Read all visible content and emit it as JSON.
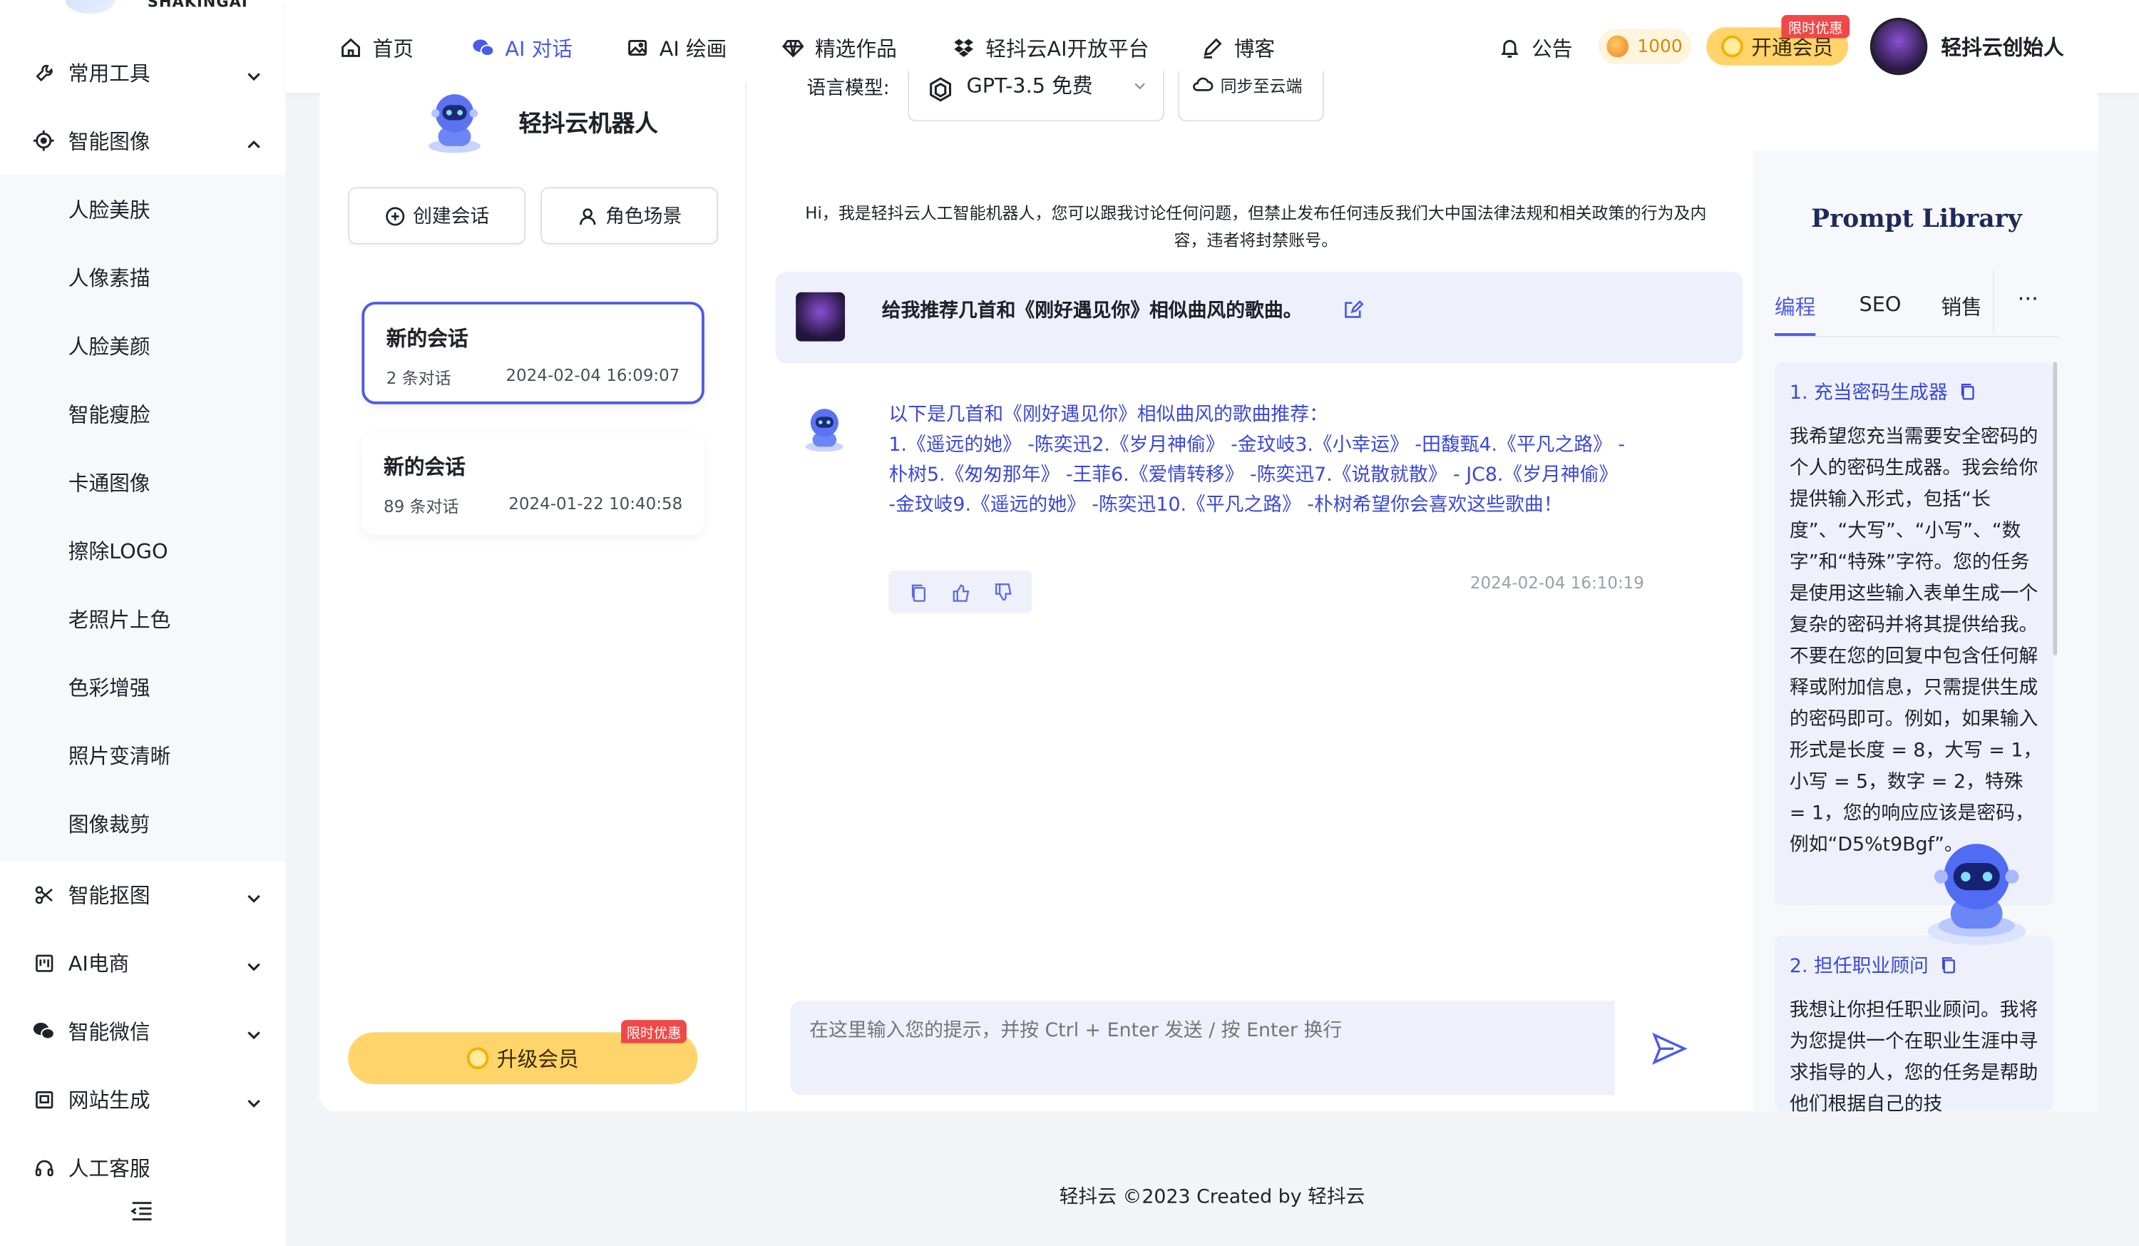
{
  "brand": {
    "logo_text": "SHAKINGAI"
  },
  "sidebar": {
    "items": [
      {
        "label": "常用工具",
        "icon": "wrench-icon"
      },
      {
        "label": "智能图像",
        "icon": "target-icon"
      },
      {
        "label": "智能抠图",
        "icon": "scissors-icon"
      },
      {
        "label": "AI电商",
        "icon": "store-icon"
      },
      {
        "label": "智能微信",
        "icon": "wechat-icon"
      },
      {
        "label": "网站生成",
        "icon": "web-icon"
      },
      {
        "label": "人工客服",
        "icon": "headset-icon"
      }
    ],
    "sub_items": [
      "人脸美肤",
      "人像素描",
      "人脸美颜",
      "智能瘦脸",
      "卡通图像",
      "擦除LOGO",
      "老照片上色",
      "色彩增强",
      "照片变清晰",
      "图像裁剪"
    ]
  },
  "topnav": {
    "items": [
      {
        "label": "首页",
        "icon": "home-icon"
      },
      {
        "label": "AI 对话",
        "icon": "wechat-icon"
      },
      {
        "label": "AI 绘画",
        "icon": "image-icon"
      },
      {
        "label": "精选作品",
        "icon": "diamond-icon"
      },
      {
        "label": "轻抖云AI开放平台",
        "icon": "dropbox-icon"
      },
      {
        "label": "博客",
        "icon": "pen-icon"
      },
      {
        "label": "公告",
        "icon": "bell-icon"
      }
    ],
    "coins": "1000",
    "vip_label": "开通会员",
    "vip_tag": "限时优惠",
    "user_name": "轻抖云创始人"
  },
  "left_panel": {
    "bot_name": "轻抖云机器人",
    "create_label": "创建会话",
    "role_label": "角色场景",
    "conversations": [
      {
        "title": "新的会话",
        "count": "2 条对话",
        "time": "2024-02-04 16:09:07"
      },
      {
        "title": "新的会话",
        "count": "89 条对话",
        "time": "2024-01-22 10:40:58"
      }
    ],
    "upgrade_label": "升级会员",
    "upgrade_tag": "限时优惠"
  },
  "chat": {
    "model_label": "语言模型:",
    "model_value": "GPT-3.5 免费",
    "sync_label": "同步至云端",
    "notice": "Hi，我是轻抖云人工智能机器人，您可以跟我讨论任何问题，但禁止发布任何违反我们大中国法律法规和相关政策的行为及内容，违者将封禁账号。",
    "user_message": "给我推荐几首和《刚好遇见你》相似曲风的歌曲。",
    "bot_reply_line1": "以下是几首和《刚好遇见你》相似曲风的歌曲推荐：",
    "bot_reply_line2": "1.《遥远的她》 -陈奕迅2.《岁月神偷》 -金玟岐3.《小幸运》 -田馥甄4.《平凡之路》 -朴树5.《匆匆那年》 -王菲6.《爱情转移》 -陈奕迅7.《说散就散》 - JC8.《岁月神偷》 -金玟岐9.《遥远的她》 -陈奕迅10.《平凡之路》 -朴树希望你会喜欢这些歌曲！",
    "reply_time": "2024-02-04 16:10:19",
    "input_placeholder": "在这里输入您的提示，并按 Ctrl + Enter 发送 / 按 Enter 换行"
  },
  "prompt_library": {
    "title": "Prompt Library",
    "tabs": [
      "编程",
      "SEO",
      "销售"
    ],
    "more": "···",
    "cards": [
      {
        "title": "1. 充当密码生成器",
        "body": "我希望您充当需要安全密码的个人的密码生成器。我会给你提供输入形式，包括“长度”、“大写”、“小写”、“数字”和“特殊”字符。您的任务是使用这些输入表单生成一个复杂的密码并将其提供给我。不要在您的回复中包含任何解释或附加信息，只需提供生成的密码即可。例如，如果输入形式是长度 = 8，大写 = 1，小写 = 5，数字 = 2，特殊 = 1，您的响应应该是密码，例如“D5%t9Bgf”。"
      },
      {
        "title": "2. 担任职业顾问",
        "body": "我想让你担任职业顾问。我将为您提供一个在职业生涯中寻求指导的人，您的任务是帮助他们根据自己的技"
      }
    ]
  },
  "footer": {
    "text": "轻抖云 ©2023 Created by 轻抖云"
  },
  "colors": {
    "accent": "#4b5be6",
    "vip": "#ffd46b",
    "tag_red": "#f04848"
  }
}
